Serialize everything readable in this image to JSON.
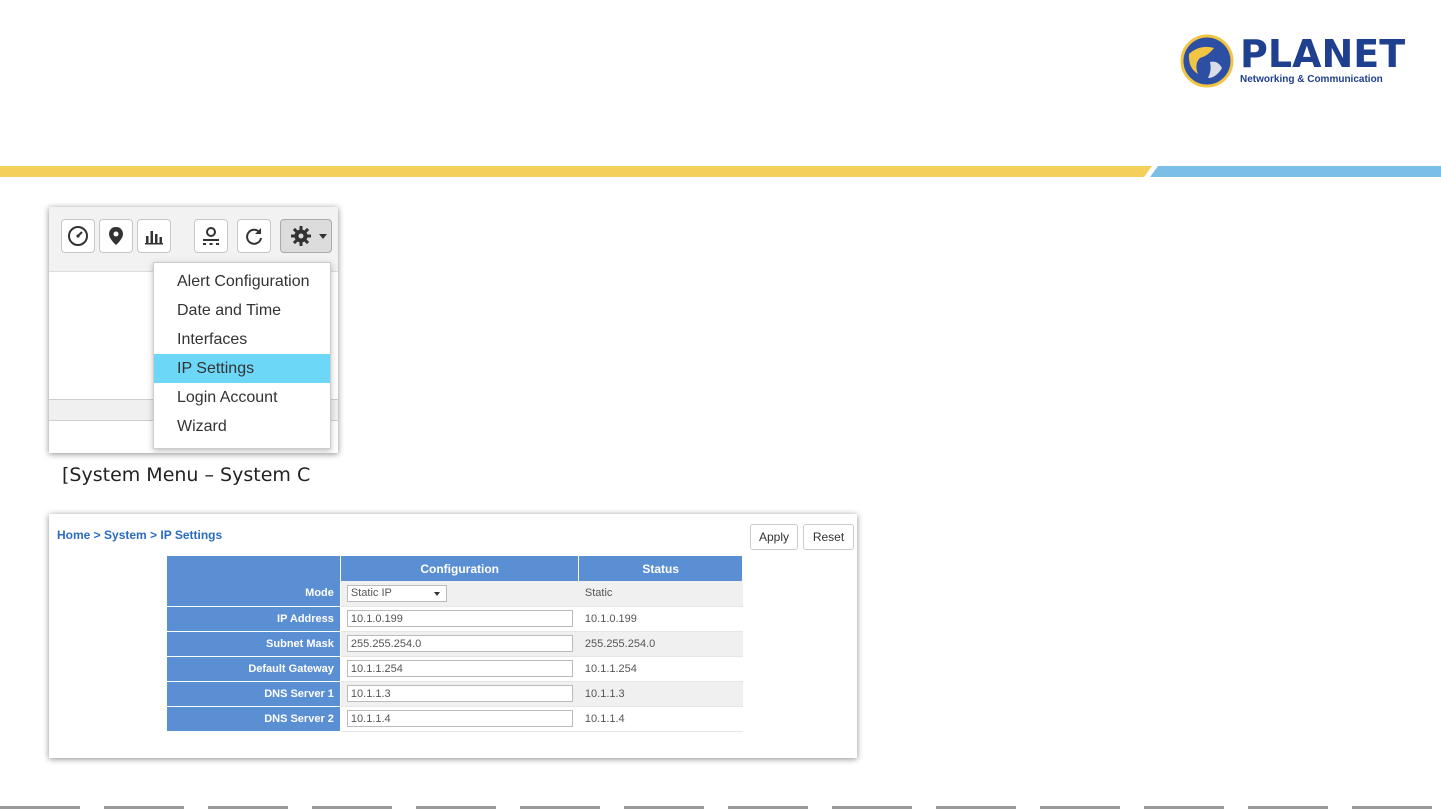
{
  "brand": {
    "name": "PLANET",
    "tagline": "Networking & Communication",
    "colors": {
      "primary": "#1f3f8f",
      "stripe_yellow": "#f4cf5a",
      "stripe_blue": "#7bbfe6"
    }
  },
  "toolbar": {
    "icons": [
      "dashboard-icon",
      "map-pin-icon",
      "bar-chart-icon",
      "topology-icon",
      "refresh-icon",
      "gear-icon"
    ]
  },
  "system_menu": {
    "items": [
      "Alert Configuration",
      "Date and Time",
      "Interfaces",
      "IP Settings",
      "Login Account",
      "Wizard"
    ],
    "active": "IP Settings",
    "highlight_color": "#6dd7f7"
  },
  "caption": "[System Menu – System C",
  "ip_settings": {
    "breadcrumb": "Home > System > IP Settings",
    "apply_label": "Apply",
    "reset_label": "Reset",
    "columns": [
      "",
      "Configuration",
      "Status"
    ],
    "mode": {
      "label": "Mode",
      "value": "Static IP",
      "status": "Static"
    },
    "ip_address": {
      "label": "IP Address",
      "value": "10.1.0.199",
      "status": "10.1.0.199"
    },
    "subnet_mask": {
      "label": "Subnet Mask",
      "value": "255.255.254.0",
      "status": "255.255.254.0"
    },
    "default_gateway": {
      "label": "Default Gateway",
      "value": "10.1.1.254",
      "status": "10.1.1.254"
    },
    "dns1": {
      "label": "DNS Server 1",
      "value": "10.1.1.3",
      "status": "10.1.1.3"
    },
    "dns2": {
      "label": "DNS Server 2",
      "value": "10.1.1.4",
      "status": "10.1.1.4"
    },
    "header_color": "#5b8fd4"
  }
}
